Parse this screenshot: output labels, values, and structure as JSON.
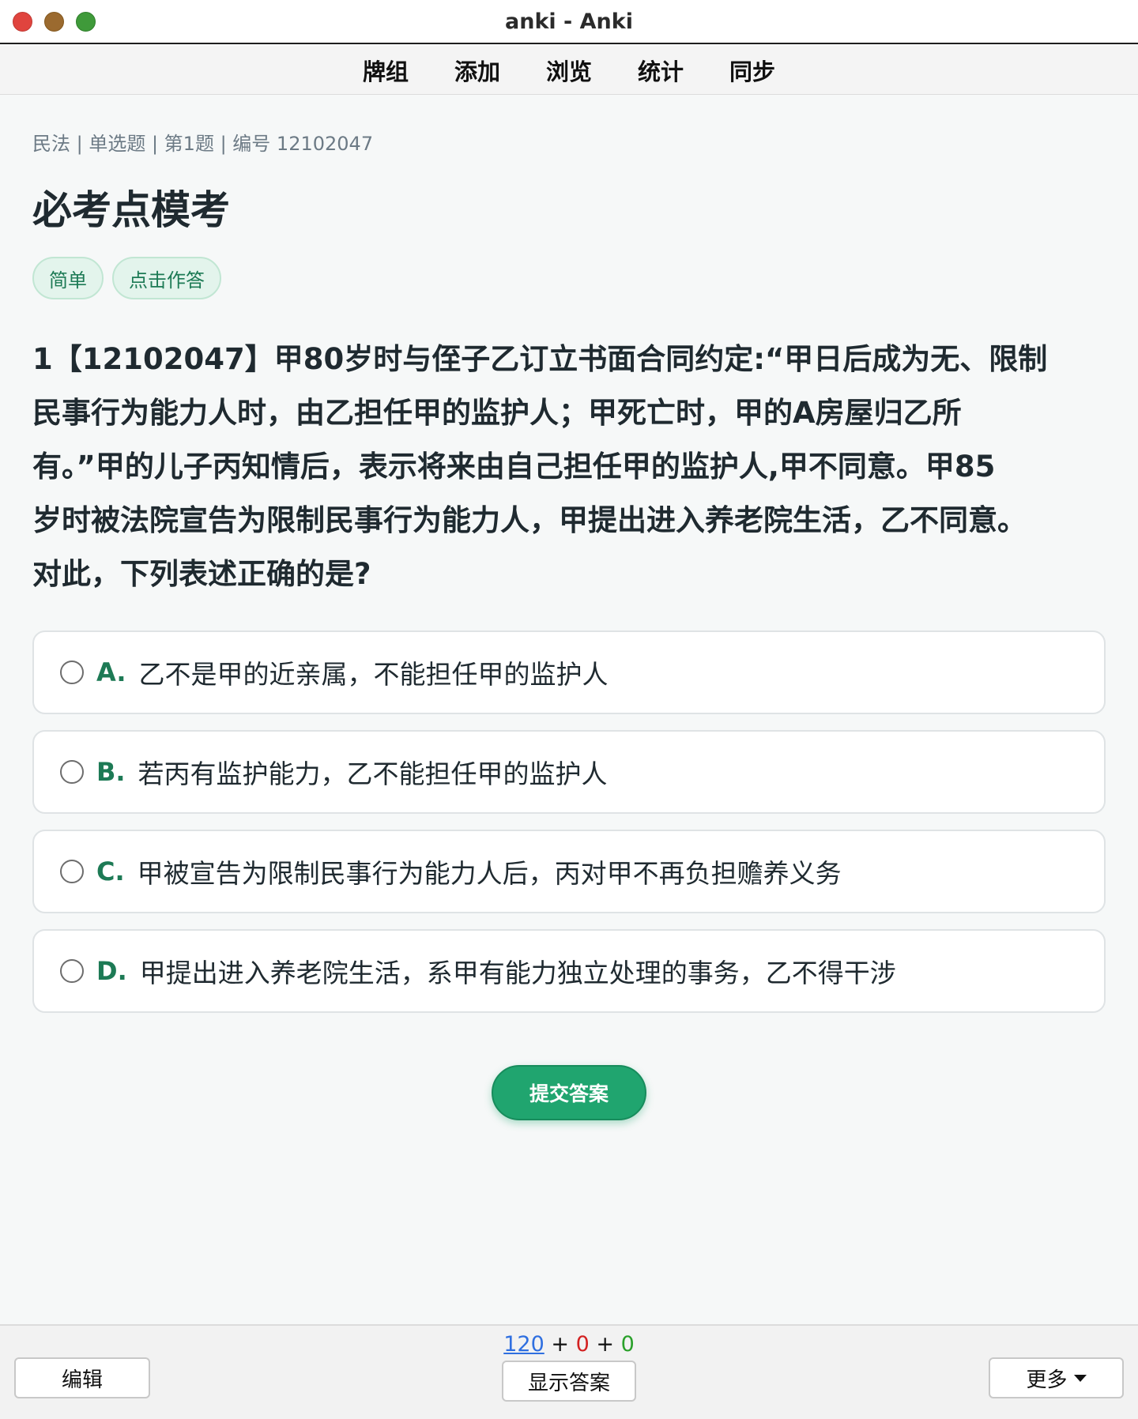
{
  "window": {
    "title": "anki - Anki"
  },
  "toolbar": {
    "items": [
      "牌组",
      "添加",
      "浏览",
      "统计",
      "同步"
    ]
  },
  "card": {
    "breadcrumb": "民法 | 单选题 | 第1题 | 编号 12102047",
    "title": "必考点模考",
    "tags": [
      "简单",
      "点击作答"
    ],
    "question_lines": [
      "1【12102047】甲80岁时与侄子乙订立书面合同约定:“甲日后成为无、限制",
      "民事行为能力人时，由乙担任甲的监护人；甲死亡时，甲的A房屋归乙所",
      "有。”甲的儿子丙知情后，表示将来由自己担任甲的监护人,甲不同意。甲85",
      "岁时被法院宣告为限制民事行为能力人，甲提出进入养老院生活，乙不同意。",
      "对此，下列表述正确的是?"
    ],
    "options": [
      {
        "key": "A.",
        "text": "乙不是甲的近亲属，不能担任甲的监护人"
      },
      {
        "key": "B.",
        "text": "若丙有监护能力，乙不能担任甲的监护人"
      },
      {
        "key": "C.",
        "text": "甲被宣告为限制民事行为能力人后，丙对甲不再负担赡养义务"
      },
      {
        "key": "D.",
        "text": "甲提出进入养老院生活，系甲有能力独立处理的事务，乙不得干涉"
      }
    ],
    "submit_label": "提交答案"
  },
  "bottom": {
    "counts": {
      "new": "120",
      "learn": "0",
      "review": "0",
      "sep": "+"
    },
    "edit_label": "编辑",
    "show_answer_label": "显示答案",
    "more_label": "更多"
  },
  "colors": {
    "accent_green": "#20a56f",
    "option_key_green": "#1d7a55",
    "count_new": "#2f6fe0",
    "count_learn": "#d32121",
    "count_review": "#2aa02a"
  }
}
